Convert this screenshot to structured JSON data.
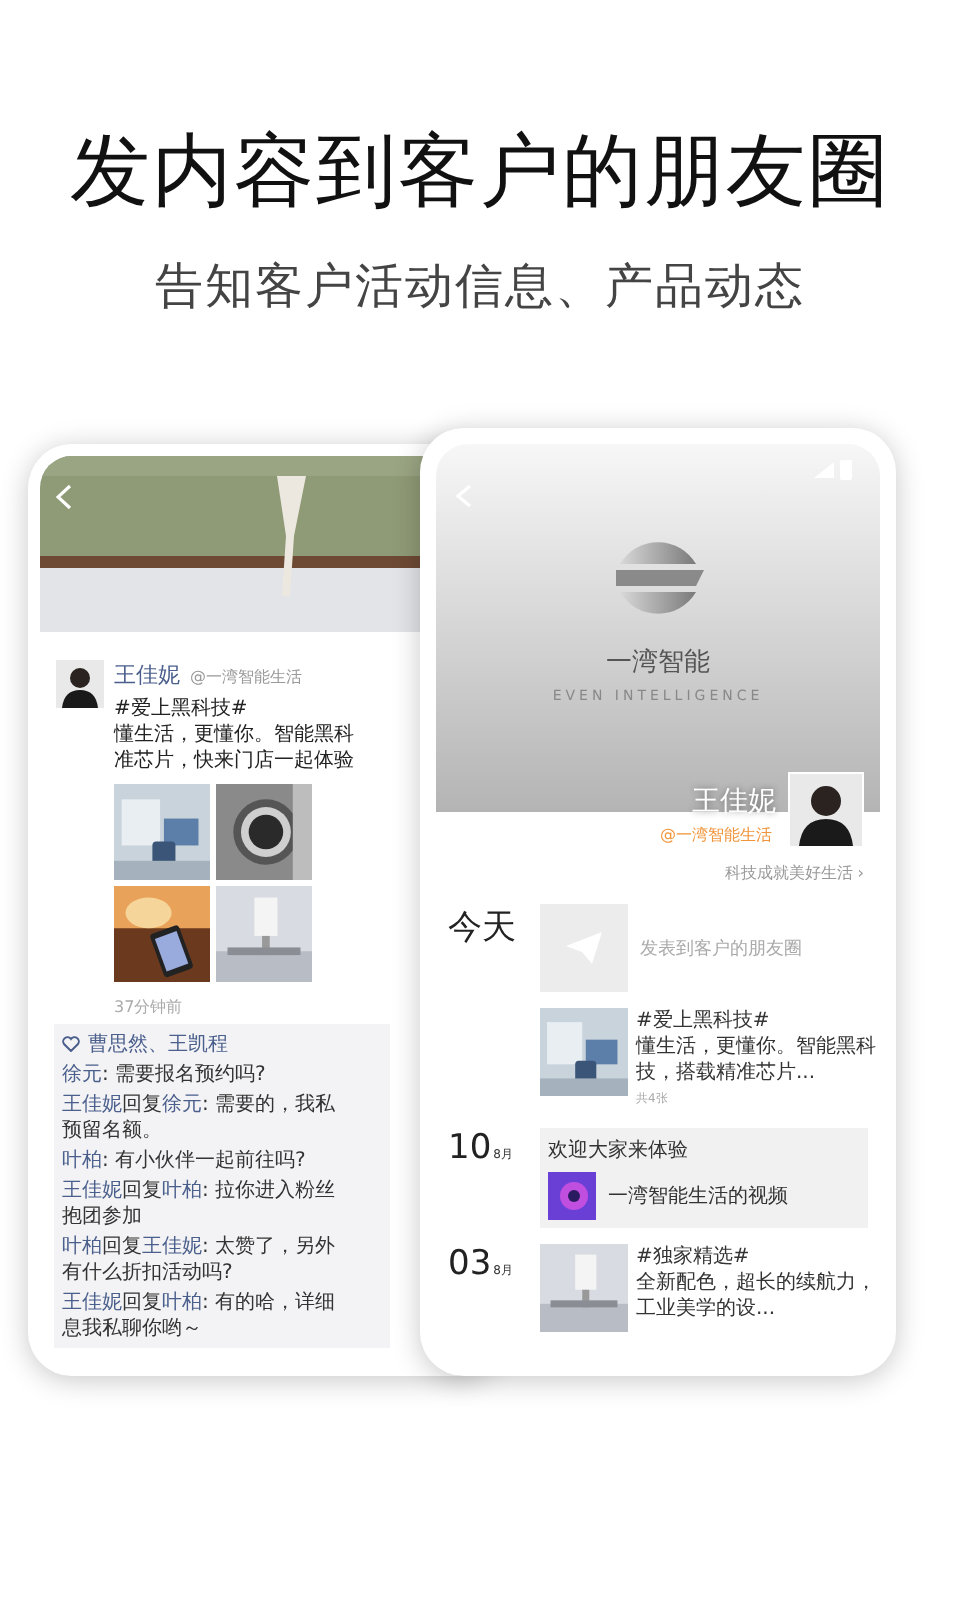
{
  "headline": "发内容到客户的朋友圈",
  "subheadline": "告知客户活动信息、产品动态",
  "moments_screen": {
    "author": "王佳妮",
    "handle": "@一湾智能生活",
    "post_lines": [
      "#爱上黑科技#",
      "懂生活，更懂你。智能黑科",
      "准芯片，快来门店一起体验"
    ],
    "time": "37分钟前",
    "likes": "曹思然、王凯程",
    "comments": [
      {
        "from": "徐元",
        "text": ": 需要报名预约吗?"
      },
      {
        "from": "王佳妮",
        "reply_label": "回复",
        "to": "徐元",
        "text": ": 需要的，我私",
        "more": "预留名额。"
      },
      {
        "from": "叶柏",
        "text": ": 有小伙伴一起前往吗?"
      },
      {
        "from": "王佳妮",
        "reply_label": "回复",
        "to": "叶柏",
        "text": ": 拉你进入粉丝",
        "more": "抱团参加"
      },
      {
        "from": "叶柏",
        "reply_label": "回复",
        "to": "王佳妮",
        "text": ": 太赞了，另外",
        "more": "有什么折扣活动吗?"
      },
      {
        "from": "王佳妮",
        "reply_label": "回复",
        "to": "叶柏",
        "text": ": 有的哈，详细",
        "more": "息我私聊你哟～"
      }
    ]
  },
  "profile_screen": {
    "brand_name": "一湾智能",
    "brand_tagline": "EVEN INTELLIGENCE",
    "owner_name": "王佳妮",
    "owner_handle": "@一湾智能生活",
    "slogan": "科技成就美好生活 ›",
    "timeline": [
      {
        "kind": "compose",
        "day": "今天",
        "placeholder": "发表到客户的朋友圈"
      },
      {
        "kind": "photo_post",
        "lines": [
          "#爱上黑科技#",
          "懂生活，更懂你。智能黑科",
          "技，搭载精准芯片..."
        ],
        "count": "共4张"
      },
      {
        "kind": "video_post",
        "day": "10",
        "month": "8月",
        "title": "欢迎大家来体验",
        "video_title": "一湾智能生活的视频"
      },
      {
        "kind": "photo_post",
        "day": "03",
        "month": "8月",
        "lines": [
          "#独家精选#",
          "全新配色，超长的续航力，",
          "工业美学的设..."
        ]
      }
    ]
  }
}
